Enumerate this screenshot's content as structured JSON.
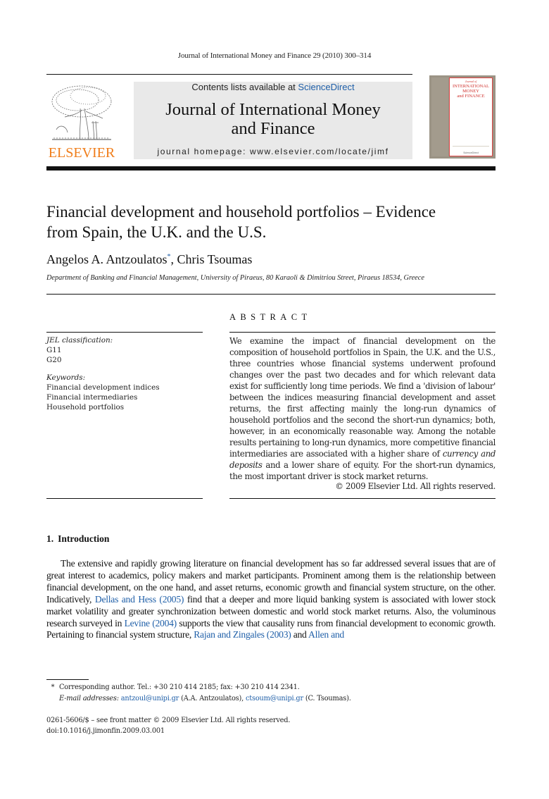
{
  "running_head": "Journal of International Money and Finance 29 (2010) 300–314",
  "masthead": {
    "publisher_logo_text": "ELSEVIER",
    "contents_prefix": "Contents lists available at ",
    "contents_link": "ScienceDirect",
    "journal_title_line1": "Journal of International Money",
    "journal_title_line2": "and Finance",
    "homepage": "journal homepage: www.elsevier.com/locate/jimf",
    "cover": {
      "small_label": "Journal of",
      "title_line1": "INTERNATIONAL",
      "title_line2": "MONEY",
      "title_line3": "and FINANCE",
      "publisher": "ScienceDirect"
    }
  },
  "article": {
    "title_line1": "Financial development and household portfolios – Evidence",
    "title_line2": "from Spain, the U.K. and the U.S.",
    "author1": "Angelos A. Antzoulatos",
    "author1_mark": "*",
    "author_sep": ", ",
    "author2": "Chris Tsoumas",
    "affiliation": "Department of Banking and Financial Management, University of Piraeus, 80 Karaoli & Dimitriou Street, Piraeus 18534, Greece"
  },
  "article_info": {
    "jel_label": "JEL classification:",
    "jel_codes": [
      "G11",
      "G20"
    ],
    "keywords_label": "Keywords:",
    "keywords": [
      "Financial development indices",
      "Financial intermediaries",
      "Household portfolios"
    ]
  },
  "abstract": {
    "heading": "ABSTRACT",
    "text_part1": "We examine the impact of financial development on the composition of household portfolios in Spain, the U.K. and the U.S., three countries whose financial systems underwent profound changes over the past two decades and for which relevant data exist for sufficiently long time periods. We find a 'division of labour' between the indices measuring financial development and asset returns, the first affecting mainly the long-run dynamics of household portfolios and the second the short-run dynamics; both, however, in an economically reasonable way. Among the notable results pertaining to long-run dynamics, more competitive financial intermediaries are associated with a higher share of ",
    "text_italic": "currency and deposits",
    "text_part2": " and a lower share of equity. For the short-run dynamics, the most important driver is stock market returns.",
    "copyright": "© 2009 Elsevier Ltd. All rights reserved."
  },
  "introduction": {
    "number": "1.",
    "heading": "Introduction",
    "p1_a": "The extensive and rapidly growing literature on financial development has so far addressed several issues that are of great interest to academics, policy makers and market participants. Prominent among them is the relationship between financial development, on the one hand, and asset returns, economic growth and financial system structure, on the other. Indicatively, ",
    "cite1": "Dellas and Hess (2005)",
    "p1_b": " find that a deeper and more liquid banking system is associated with lower stock market volatility and greater synchronization between domestic and world stock market returns. Also, the voluminous research surveyed in ",
    "cite2": "Levine (2004)",
    "p1_c": " supports the view that causality runs from financial development to economic growth. Pertaining to financial system structure, ",
    "cite3": "Rajan and Zingales (2003)",
    "p1_d": " and ",
    "cite4": "Allen and"
  },
  "footnotes": {
    "star": "*",
    "corresponding": "Corresponding author. Tel.: +30 210 414 2185; fax: +30 210 414 2341.",
    "email_label": "E-mail addresses:",
    "email1": "antzoul@unipi.gr",
    "email1_owner": " (A.A. Antzoulatos), ",
    "email2": "ctsoum@unipi.gr",
    "email2_owner": " (C. Tsoumas)."
  },
  "front_matter": {
    "issn_line": "0261-5606/$ – see front matter © 2009 Elsevier Ltd. All rights reserved.",
    "doi": "doi:10.1016/j.jimonfin.2009.03.001"
  }
}
